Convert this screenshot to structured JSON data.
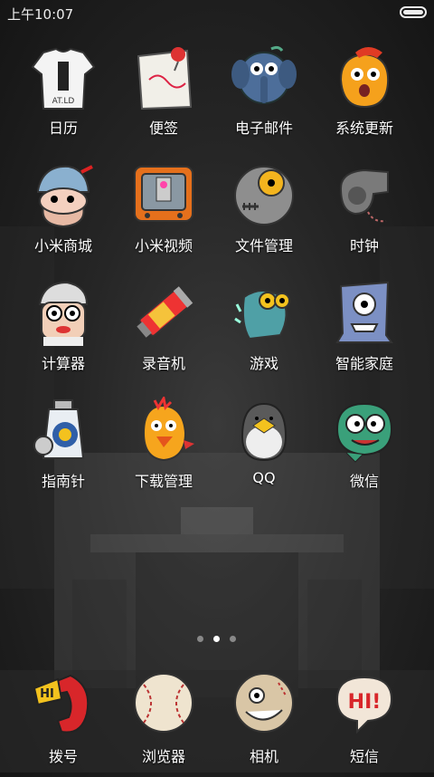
{
  "status": {
    "time": "上午10:07"
  },
  "apps": [
    {
      "label": "日历"
    },
    {
      "label": "便签"
    },
    {
      "label": "电子邮件"
    },
    {
      "label": "系统更新"
    },
    {
      "label": "小米商城"
    },
    {
      "label": "小米视频"
    },
    {
      "label": "文件管理"
    },
    {
      "label": "时钟"
    },
    {
      "label": "计算器"
    },
    {
      "label": "录音机"
    },
    {
      "label": "游戏"
    },
    {
      "label": "智能家庭"
    },
    {
      "label": "指南针"
    },
    {
      "label": "下载管理"
    },
    {
      "label": "QQ"
    },
    {
      "label": "微信"
    }
  ],
  "dock": [
    {
      "label": "拨号"
    },
    {
      "label": "浏览器"
    },
    {
      "label": "相机"
    },
    {
      "label": "短信"
    }
  ],
  "icon_badge_text": {
    "calendar_shirt": "AT.LD",
    "messages": "HI!",
    "phone": "HI"
  },
  "pager": {
    "pages": 3,
    "active_index": 1
  }
}
